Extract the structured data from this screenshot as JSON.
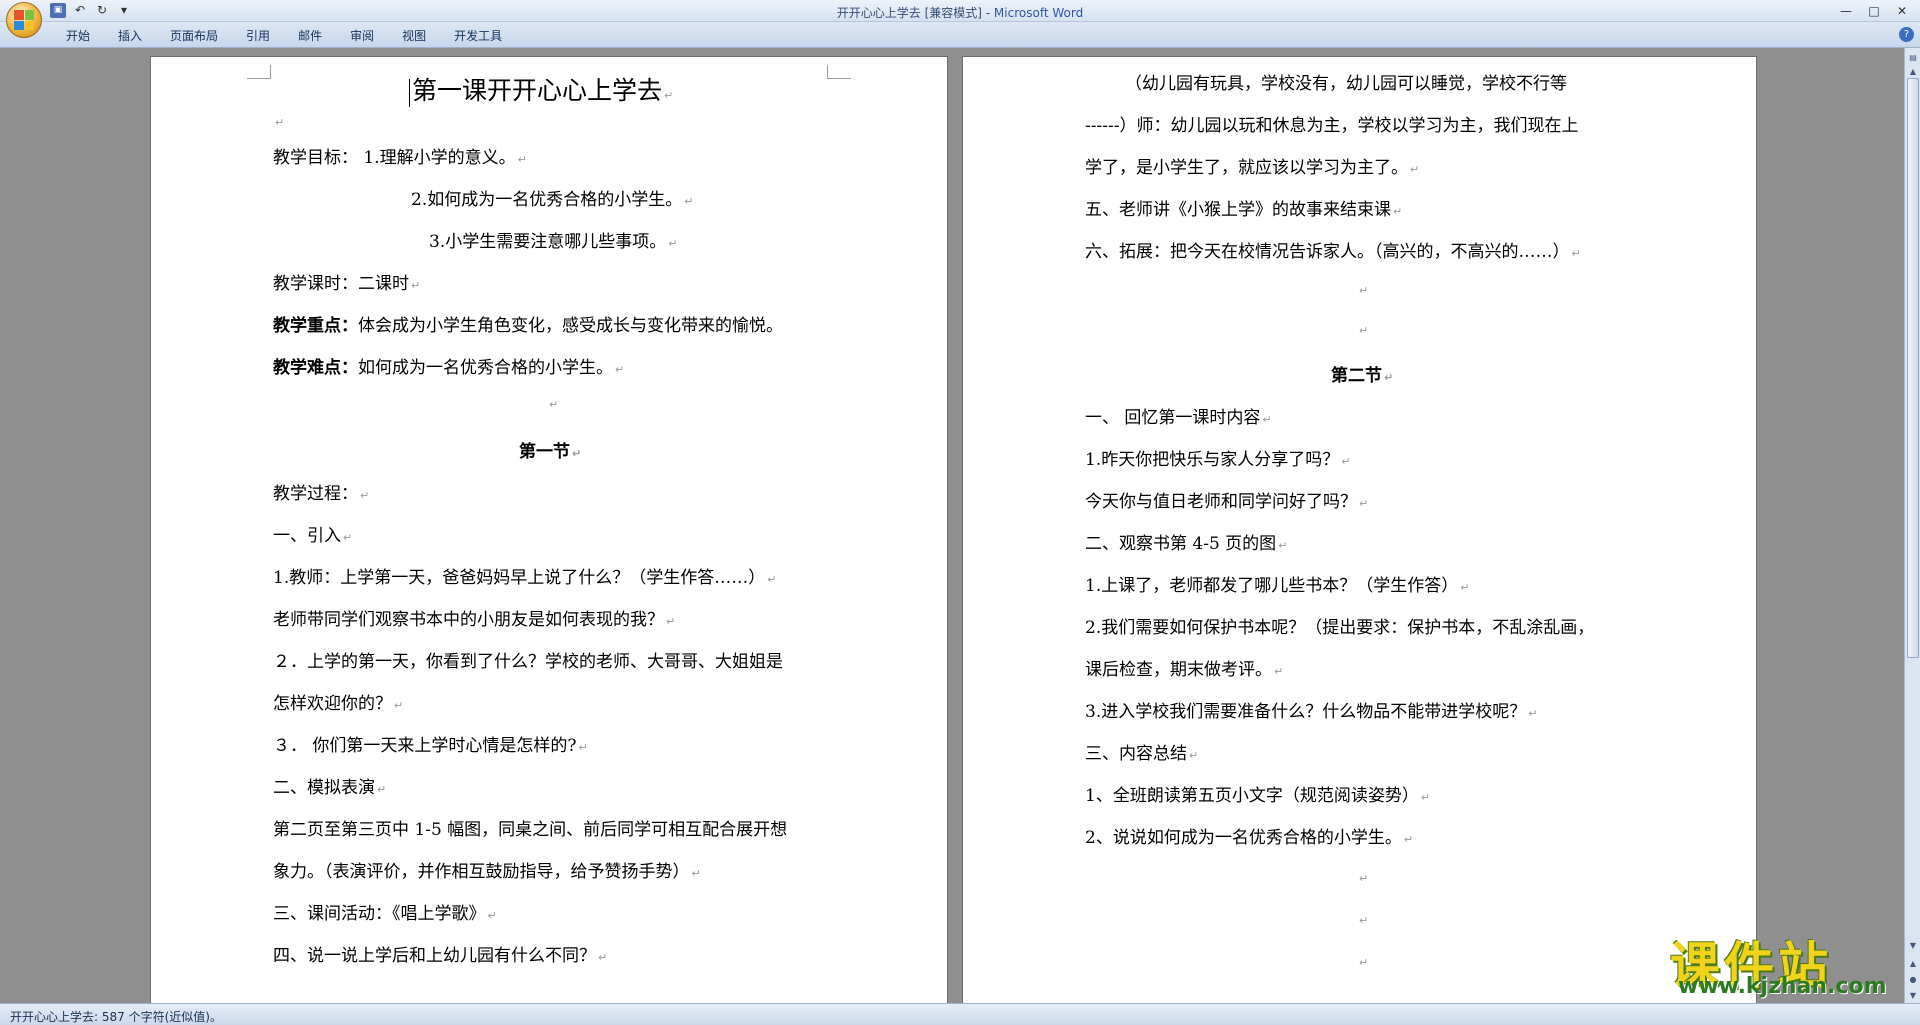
{
  "window": {
    "title": "开开心心上学去 [兼容模式] - ",
    "app_name": "Microsoft Word",
    "controls": [
      "—",
      "□",
      "✕"
    ]
  },
  "ribbon": {
    "tabs": [
      "开始",
      "插入",
      "页面布局",
      "引用",
      "邮件",
      "审阅",
      "视图",
      "开发工具"
    ]
  },
  "page_left": {
    "title": "第一课开开心心上学去",
    "objectives_label": "教学目标：",
    "objective_1": " 1.理解小学的意义。",
    "objective_2": "2.如何成为一名优秀合格的小学生。",
    "objective_3": "3.小学生需要注意哪儿些事项。",
    "hours": "教学课时：二课时",
    "focus_label": "教学重点：",
    "focus_text": "体会成为小学生角色变化，感受成长与变化带来的愉悦。",
    "difficulty_label": "教学难点：",
    "difficulty_text": "如何成为一名优秀合格的小学生。",
    "section_1": "第一节",
    "process": "教学过程：",
    "intro": "一、引入",
    "q1": "1.教师：上学第一天，爸爸妈妈早上说了什么？（学生作答……）",
    "q1b": "老师带同学们观察书本中的小朋友是如何表现的我？",
    "q2": "２．上学的第一天，你看到了什么？学校的老师、大哥哥、大姐姐是",
    "q2b": "怎样欢迎你的？",
    "q3": "３． 你们第一天来上学时心情是怎样的?",
    "part2": "二、模拟表演",
    "part2a": "第二页至第三页中 1-5 幅图，同桌之间、前后同学可相互配合展开想",
    "part2b": "象力。（表演评价，并作相互鼓励指导，给予赞扬手势）",
    "part3": "三、课间活动：《唱上学歌》",
    "part4": "四、说一说上学后和上幼儿园有什么不同？"
  },
  "page_right": {
    "r1": "（幼儿园有玩具，学校没有，幼儿园可以睡觉，学校不行等",
    "r2": "------）师：幼儿园以玩和休息为主，学校以学习为主，我们现在上",
    "r3": "学了，是小学生了，就应该以学习为主了。",
    "r4": "五、老师讲《小猴上学》的故事来结束课",
    "r5": "六、拓展：把今天在校情况告诉家人。（高兴的，不高兴的……）",
    "section_2": "第二节",
    "s1": "一、 回忆第一课时内容",
    "s2": "1.昨天你把快乐与家人分享了吗？",
    "s3": "今天你与值日老师和同学问好了吗？",
    "s4": "二、观察书第 4-5 页的图",
    "s5": "1.上课了，老师都发了哪儿些书本？（学生作答）",
    "s6": "2.我们需要如何保护书本呢？（提出要求：保护书本，不乱涂乱画，",
    "s7": "课后检查，期末做考评。",
    "s8": "3.进入学校我们需要准备什么？什么物品不能带进学校呢？",
    "s9": "三、内容总结",
    "s10": "1、全班朗读第五页小文字（规范阅读姿势）",
    "s11": "2、说说如何成为一名优秀合格的小学生。"
  },
  "paragraph_mark": "↵",
  "status": {
    "text": "开开心心上学去: 587 个字符(近似值)。"
  },
  "watermark": {
    "brand": "课件站",
    "url": "www.kjzhan.com"
  },
  "colors": {
    "title_app": "#2b56a8",
    "watermark_yellow": "#f2d31c",
    "watermark_green": "#2b7c20"
  }
}
